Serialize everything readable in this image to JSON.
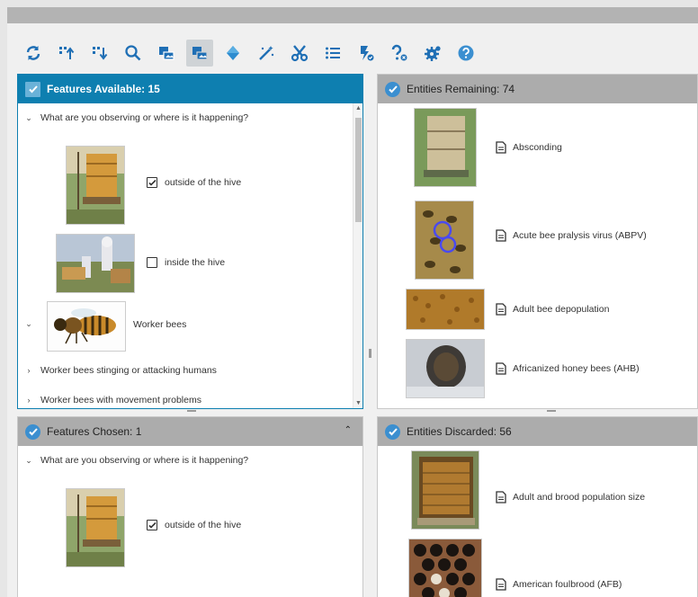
{
  "toolbar": {
    "buttons": [
      {
        "icon": "refresh-icon",
        "active": false
      },
      {
        "icon": "sort-up-icon",
        "active": false
      },
      {
        "icon": "sort-down-icon",
        "active": false
      },
      {
        "icon": "search-icon",
        "active": false
      },
      {
        "icon": "image-toggle-icon",
        "active": false
      },
      {
        "icon": "image-toggle-active-icon",
        "active": true
      },
      {
        "icon": "diamond-icon",
        "active": false
      },
      {
        "icon": "magic-wand-icon",
        "active": false
      },
      {
        "icon": "scissors-icon",
        "active": false
      },
      {
        "icon": "list-icon",
        "active": false
      },
      {
        "icon": "flash-check-icon",
        "active": false
      },
      {
        "icon": "question-remove-icon",
        "active": false
      },
      {
        "icon": "settings-gear-icon",
        "active": false
      },
      {
        "icon": "help-icon",
        "active": false
      }
    ],
    "accent": "#1f6fb5"
  },
  "features_available": {
    "title": "Features Available: 15",
    "question": "What are you observing or where is it happening?",
    "options": [
      {
        "label": "outside of the hive",
        "checked": true
      },
      {
        "label": "inside the hive",
        "checked": false
      }
    ],
    "group": "Worker bees",
    "sub_items": [
      "Worker bees stinging or attacking humans",
      "Worker bees with movement problems"
    ]
  },
  "entities_remaining": {
    "title": "Entities Remaining: 74",
    "items": [
      "Absconding",
      "Acute bee pralysis virus (ABPV)",
      "Adult bee depopulation",
      "Africanized honey bees (AHB)"
    ]
  },
  "features_chosen": {
    "title": "Features Chosen: 1",
    "question": "What are you observing or where is it happening?",
    "option": {
      "label": "outside of the hive",
      "checked": true
    }
  },
  "entities_discarded": {
    "title": "Entities Discarded: 56",
    "items": [
      "Adult and brood population size",
      "American foulbrood (AFB)"
    ]
  },
  "colors": {
    "header_blue": "#0e7fb0",
    "header_gray": "#acacac",
    "panel_border_active": "#0e7fb0"
  }
}
